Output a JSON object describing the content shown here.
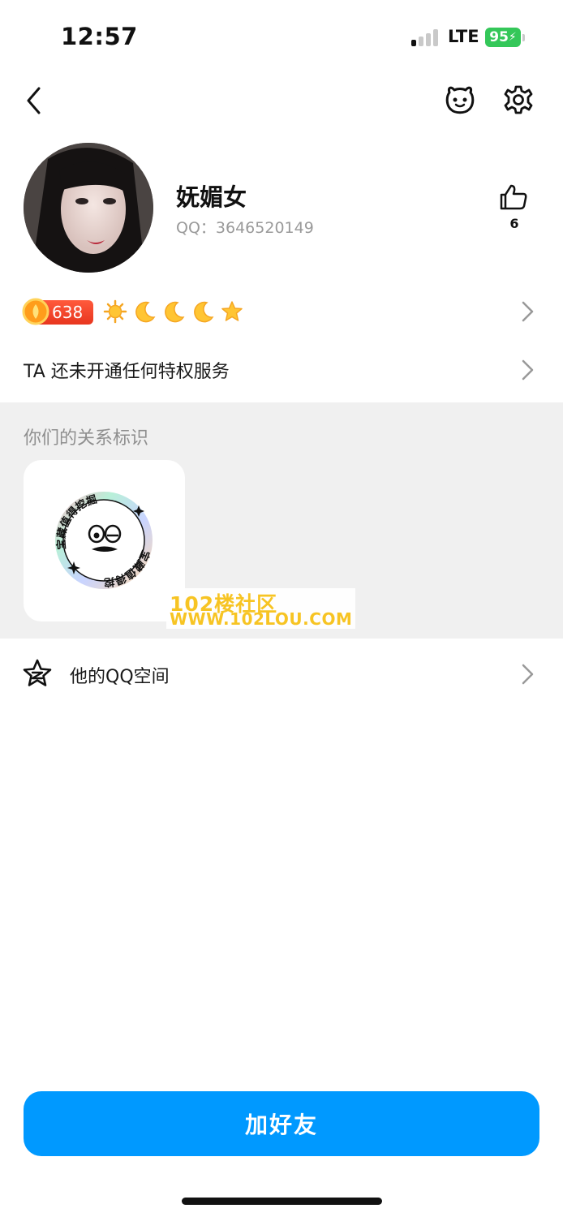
{
  "status_bar": {
    "time": "12:57",
    "network": "LTE",
    "battery": "95"
  },
  "nav": {
    "back_icon": "chevron-left-icon",
    "pet_icon": "pet-face-icon",
    "settings_icon": "gear-icon"
  },
  "profile": {
    "nickname": "妩媚女",
    "qq_label": "QQ：",
    "qq_number": "3646520149",
    "like_count": "6"
  },
  "level": {
    "coin_value": "638",
    "icons": [
      "sun-icon",
      "moon-icon",
      "moon-icon",
      "moon-icon",
      "star-icon"
    ]
  },
  "privilege": {
    "text": "TA 还未开通任何特权服务"
  },
  "relation": {
    "title": "你们的关系标识",
    "badge_text": "宝藏值得挖掘"
  },
  "watermark": {
    "line1": "102楼社区",
    "line2": "WWW.102LOU.COM"
  },
  "qzone": {
    "label": "他的QQ空间"
  },
  "action": {
    "add_friend": "加好友"
  },
  "colors": {
    "accent": "#0099ff",
    "coin_badge": "#e8361f",
    "level_gold": "#f5a623",
    "section_bg": "#f0f0f0"
  }
}
